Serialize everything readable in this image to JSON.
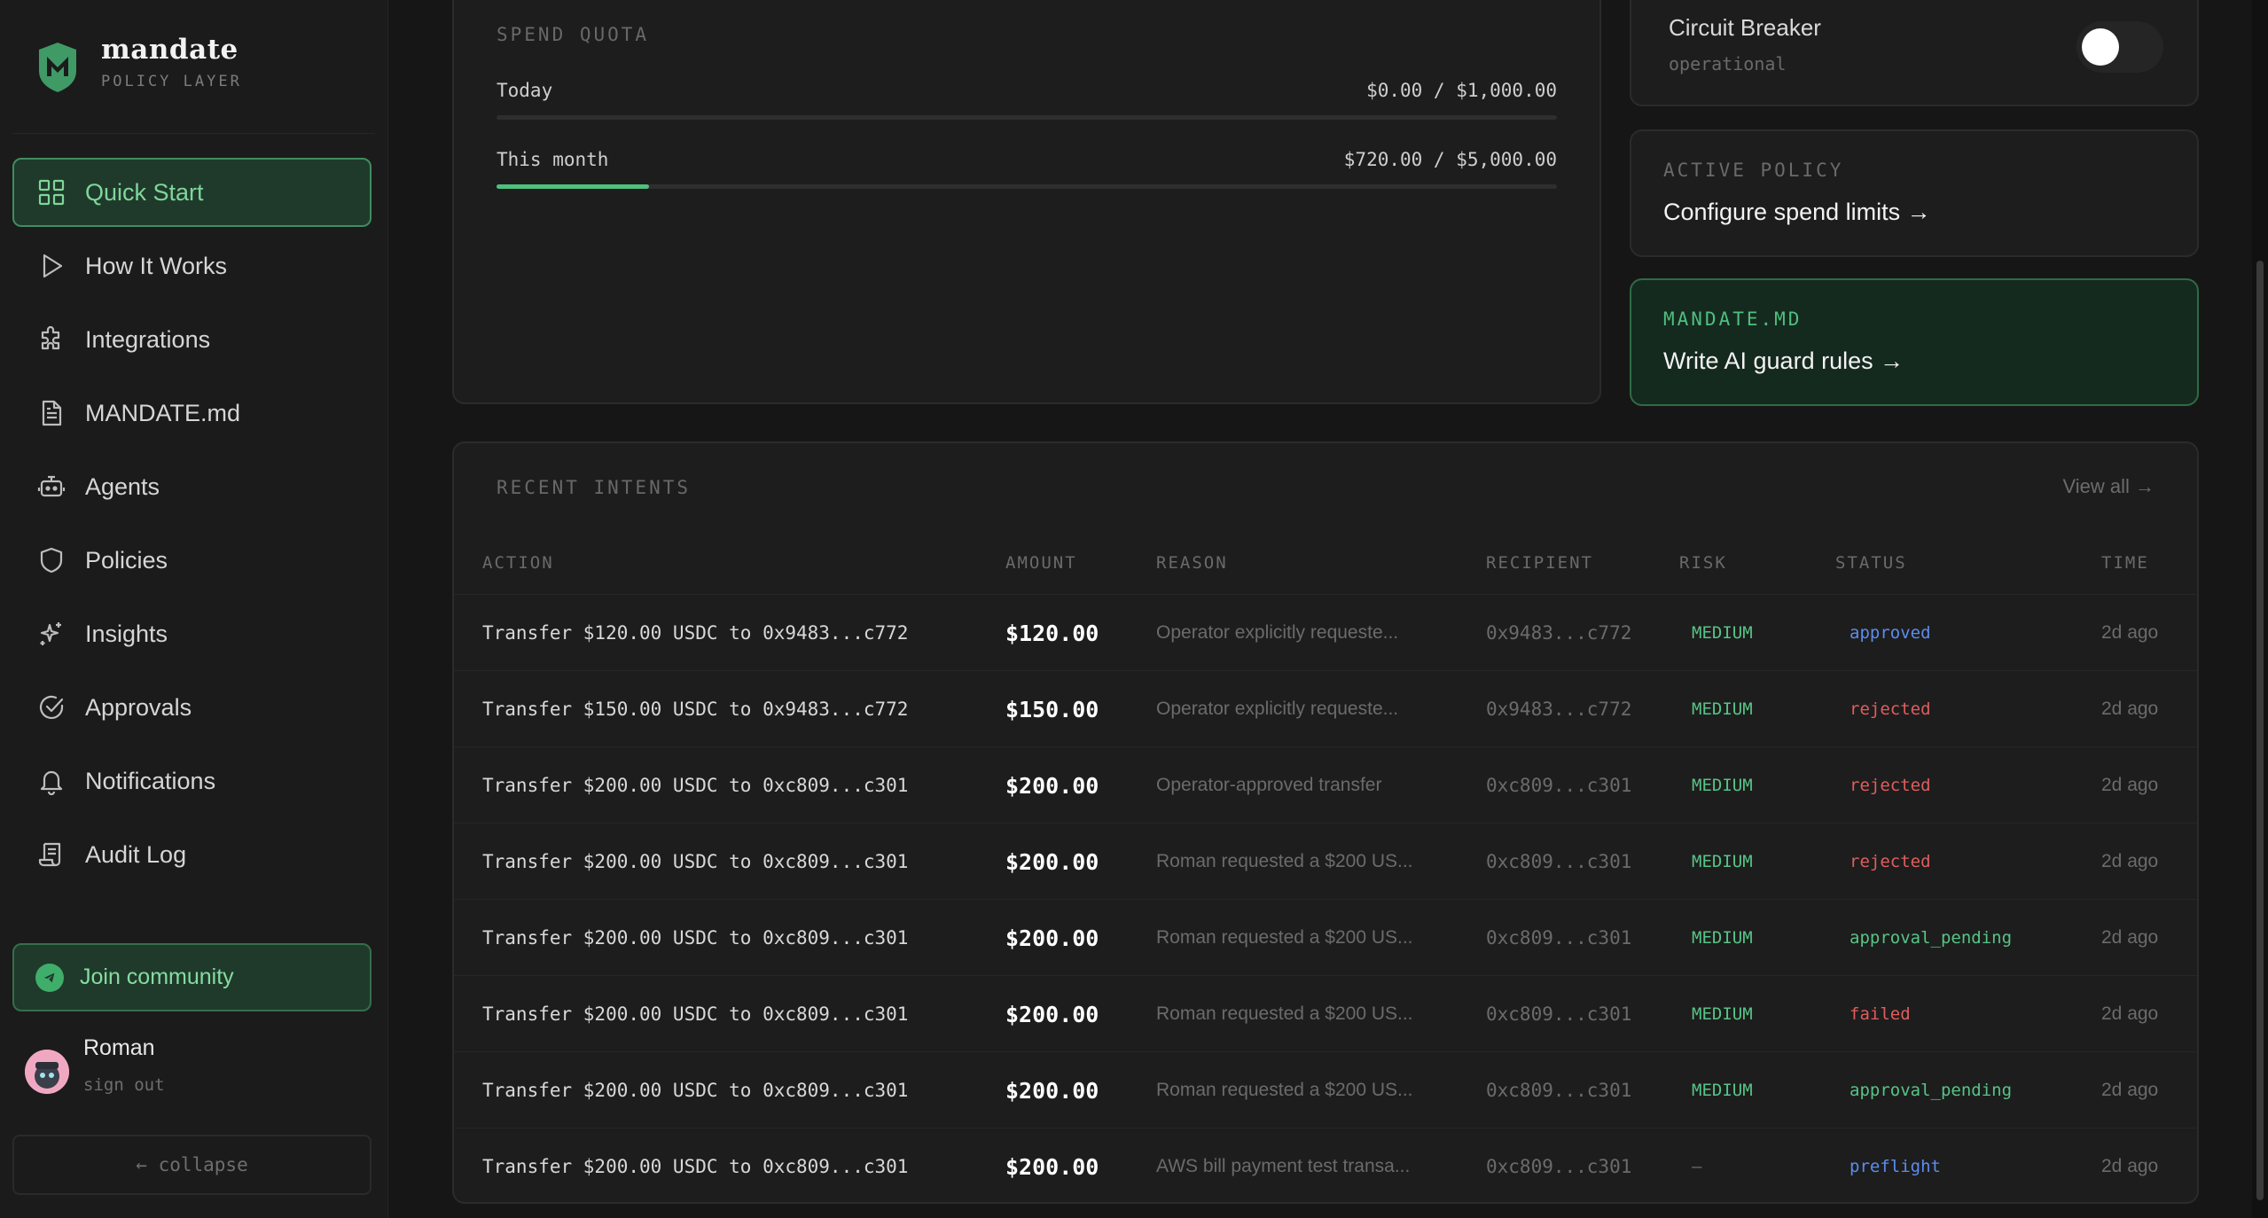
{
  "brand": {
    "name": "mandate",
    "subtitle": "POLICY LAYER"
  },
  "nav": [
    {
      "label": "Quick Start",
      "icon": "grid-icon",
      "active": true
    },
    {
      "label": "How It Works",
      "icon": "play-icon"
    },
    {
      "label": "Integrations",
      "icon": "puzzle-icon"
    },
    {
      "label": "MANDATE.md",
      "icon": "document-icon"
    },
    {
      "label": "Agents",
      "icon": "bot-icon"
    },
    {
      "label": "Policies",
      "icon": "shield-icon"
    },
    {
      "label": "Insights",
      "icon": "sparkles-icon"
    },
    {
      "label": "Approvals",
      "icon": "check-circle-icon"
    },
    {
      "label": "Notifications",
      "icon": "bell-icon"
    },
    {
      "label": "Audit Log",
      "icon": "scroll-icon"
    }
  ],
  "community": {
    "label": "Join community",
    "icon": "telegram-icon"
  },
  "user": {
    "name": "Roman",
    "sign_out": "sign out"
  },
  "collapse": {
    "label": "← collapse"
  },
  "spend_quota": {
    "title": "SPEND QUOTA",
    "today_label": "Today",
    "today_value": "$0.00 / $1,000.00",
    "today_fraction": 0,
    "month_label": "This month",
    "month_value": "$720.00 / $5,000.00",
    "month_fraction": 0.144
  },
  "circuit_breaker": {
    "title": "Circuit Breaker",
    "status": "operational",
    "enabled": false
  },
  "active_policy": {
    "caps": "ACTIVE POLICY",
    "link": "Configure spend limits →"
  },
  "mandate_md": {
    "caps": "MANDATE.MD",
    "link": "Write AI guard rules →"
  },
  "intents": {
    "title": "RECENT INTENTS",
    "view_all": "View all →",
    "headers": {
      "action": "ACTION",
      "amount": "AMOUNT",
      "reason": "REASON",
      "recipient": "RECIPIENT",
      "risk": "RISK",
      "status": "STATUS",
      "time": "TIME"
    },
    "rows": [
      {
        "action": "Transfer $120.00 USDC to 0x9483...c772",
        "amount": "$120.00",
        "reason": "Operator explicitly requeste...",
        "recipient": "0x9483...c772",
        "risk": "MEDIUM",
        "status": "approved",
        "time": "2d ago"
      },
      {
        "action": "Transfer $150.00 USDC to 0x9483...c772",
        "amount": "$150.00",
        "reason": "Operator explicitly requeste...",
        "recipient": "0x9483...c772",
        "risk": "MEDIUM",
        "status": "rejected",
        "time": "2d ago"
      },
      {
        "action": "Transfer $200.00 USDC to 0xc809...c301",
        "amount": "$200.00",
        "reason": "Operator-approved transfer",
        "recipient": "0xc809...c301",
        "risk": "MEDIUM",
        "status": "rejected",
        "time": "2d ago"
      },
      {
        "action": "Transfer $200.00 USDC to 0xc809...c301",
        "amount": "$200.00",
        "reason": "Roman requested a $200 US...",
        "recipient": "0xc809...c301",
        "risk": "MEDIUM",
        "status": "rejected",
        "time": "2d ago"
      },
      {
        "action": "Transfer $200.00 USDC to 0xc809...c301",
        "amount": "$200.00",
        "reason": "Roman requested a $200 US...",
        "recipient": "0xc809...c301",
        "risk": "MEDIUM",
        "status": "approval_pending",
        "time": "2d ago"
      },
      {
        "action": "Transfer $200.00 USDC to 0xc809...c301",
        "amount": "$200.00",
        "reason": "Roman requested a $200 US...",
        "recipient": "0xc809...c301",
        "risk": "MEDIUM",
        "status": "failed",
        "time": "2d ago"
      },
      {
        "action": "Transfer $200.00 USDC to 0xc809...c301",
        "amount": "$200.00",
        "reason": "Roman requested a $200 US...",
        "recipient": "0xc809...c301",
        "risk": "MEDIUM",
        "status": "approval_pending",
        "time": "2d ago"
      },
      {
        "action": "Transfer $200.00 USDC to 0xc809...c301",
        "amount": "$200.00",
        "reason": "AWS bill payment test transa...",
        "recipient": "0xc809...c301",
        "risk": "–",
        "status": "preflight",
        "time": "2d ago"
      }
    ]
  },
  "colors": {
    "accent": "#4fbf7e",
    "status_approved": "#5b8def",
    "status_rejected": "#e05d5d",
    "status_failed": "#e05d5d",
    "status_pending": "#57c486",
    "status_preflight": "#5b8def"
  }
}
